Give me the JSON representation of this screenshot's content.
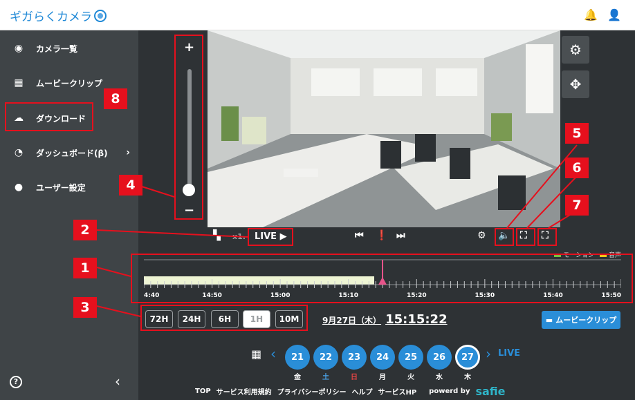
{
  "header": {
    "logo_text": "ギガらくカメラ",
    "icons": [
      "bell-icon",
      "user-icon"
    ]
  },
  "sidebar": {
    "items": [
      {
        "label": "カメラ一覧",
        "icon": "camera-icon"
      },
      {
        "label": "ムービークリップ",
        "icon": "film-icon"
      },
      {
        "label": "ダウンロード",
        "icon": "cloud-download-icon"
      },
      {
        "label": "ダッシュボード(β)",
        "icon": "dashboard-icon"
      },
      {
        "label": "ユーザー設定",
        "icon": "user-icon"
      }
    ]
  },
  "video": {
    "zoom_plus": "+",
    "zoom_minus": "−",
    "zoom_level": 0.0
  },
  "controls": {
    "speed": "x1.",
    "live_label": "LIVE ▶"
  },
  "legend": {
    "motion": "モーション",
    "audio": "音声",
    "motion_color": "#7bc043",
    "audio_color": "#f5c518"
  },
  "timeline": {
    "ticks": [
      "4:40",
      "14:50",
      "15:00",
      "15:10",
      "15:20",
      "15:30",
      "15:40",
      "15:50"
    ]
  },
  "ranges": [
    "72H",
    "24H",
    "6H",
    "1H",
    "10M"
  ],
  "active_range": "1H",
  "current": {
    "date": "9月27日（木）",
    "time": "15:15:22"
  },
  "movie_clip_label": "ムービークリップ",
  "calendar": {
    "days": [
      {
        "num": "21",
        "wd": "金",
        "color": "#ffffff"
      },
      {
        "num": "22",
        "wd": "土",
        "color": "#4aa3e8"
      },
      {
        "num": "23",
        "wd": "日",
        "color": "#e64545"
      },
      {
        "num": "24",
        "wd": "月",
        "color": "#ffffff"
      },
      {
        "num": "25",
        "wd": "火",
        "color": "#ffffff"
      },
      {
        "num": "26",
        "wd": "水",
        "color": "#ffffff"
      },
      {
        "num": "27",
        "wd": "木",
        "color": "#ffffff"
      }
    ],
    "live_label": "LIVE"
  },
  "footer": {
    "links": [
      "TOP",
      "サービス利用規約",
      "プライバシーポリシー",
      "ヘルプ",
      "サービスHP"
    ],
    "powered": "powerd by",
    "brand": "safie"
  },
  "callouts": [
    "1",
    "2",
    "3",
    "4",
    "5",
    "6",
    "7",
    "8"
  ]
}
